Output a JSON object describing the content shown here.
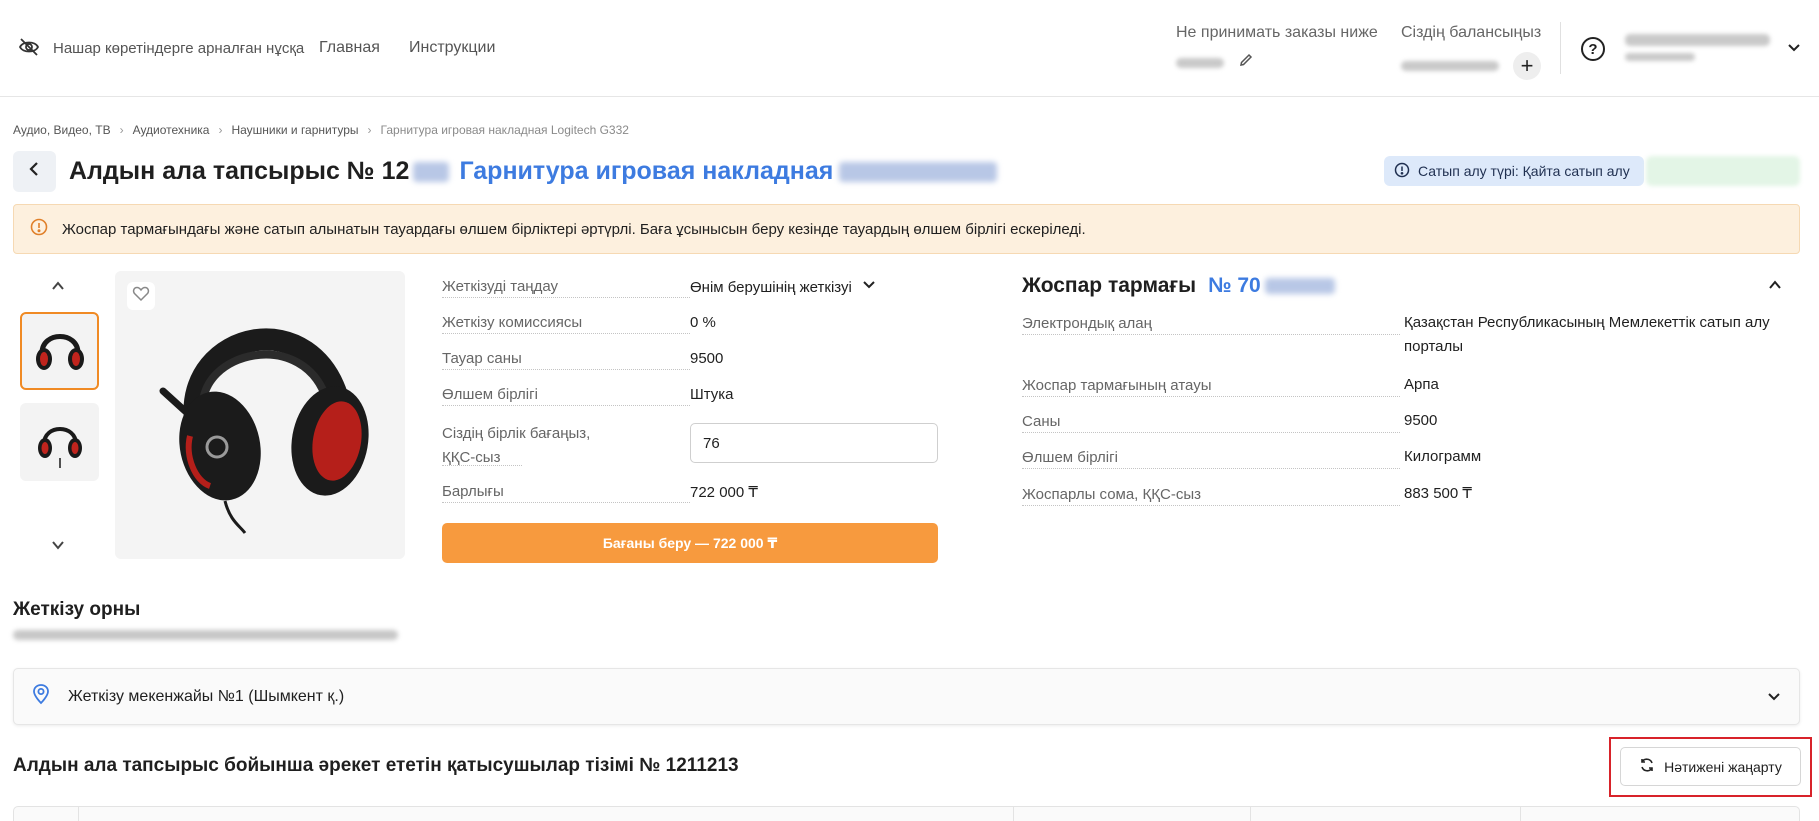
{
  "header": {
    "vision_label": "Нашар көретіндерге арналған нұсқа",
    "nav": [
      "Главная",
      "Инструкции"
    ],
    "min_order_label": "Не принимать заказы ниже",
    "balance_label": "Сіздің балансыңыз",
    "help_symbol": "?",
    "plus_symbol": "+",
    "icons": [
      "eye-slash-icon",
      "pencil-icon",
      "help-icon",
      "chevron-down-icon"
    ]
  },
  "breadcrumb": [
    "Аудио, Видео, ТВ",
    "Аудиотехника",
    "Наушники и гарнитуры",
    "Гарнитура игровая накладная Logitech G332"
  ],
  "page": {
    "title_prefix": "Алдын ала тапсырыс № 12",
    "title_product": "Гарнитура игровая накладная",
    "buy_type": "Сатып алу түрі: Қайта сатып алу"
  },
  "warning": "Жоспар тармағындағы және сатып алынатын тауардағы өлшем бірліктері әртүрлі. Баға ұсынысын беру кезінде тауардың өлшем бірлігі ескеріледі.",
  "offer": {
    "delivery_choice_label": "Жеткізуді таңдау",
    "delivery_choice_value": "Өнім берушінің жеткізуі",
    "commission_label": "Жеткізу комиссиясы",
    "commission_value": "0 %",
    "quantity_label": "Тауар саны",
    "quantity_value": "9500",
    "unit_label": "Өлшем бірлігі",
    "unit_value": "Штука",
    "price_label_1": "Сіздің бірлік бағаңыз,",
    "price_label_2": "ҚҚС-сыз",
    "price_value": "76",
    "total_label": "Барлығы",
    "total_value": "722 000 ₸",
    "submit_label": "Бағаны беру — 722 000 ₸"
  },
  "plan": {
    "title": "Жоспар тармағы",
    "number_prefix": "№ 70",
    "rows": [
      {
        "label": "Электрондық алаң",
        "value": "Қазақстан Республикасының Мемлекеттік сатып алу порталы"
      },
      {
        "label": "Жоспар тармағының атауы",
        "value": "Арпа"
      },
      {
        "label": "Саны",
        "value": "9500"
      },
      {
        "label": "Өлшем бірлігі",
        "value": "Килограмм"
      },
      {
        "label": "Жоспарлы сома, ҚҚС-сыз",
        "value": "883 500 ₸"
      }
    ]
  },
  "delivery": {
    "title": "Жеткізу орны",
    "address_label": "Жеткізу мекенжайы №1 (Шымкент қ.)"
  },
  "participants": {
    "title": "Алдын ала тапсырыс бойынша әрекет ететін қатысушылар тізімі № 1211213",
    "refresh_label": "Нәтижені жаңарту"
  },
  "colors": {
    "accent_blue": "#3d7be0",
    "accent_orange": "#f79a3e",
    "warning_bg": "#fdf0de",
    "highlight_red": "#d8232a"
  }
}
